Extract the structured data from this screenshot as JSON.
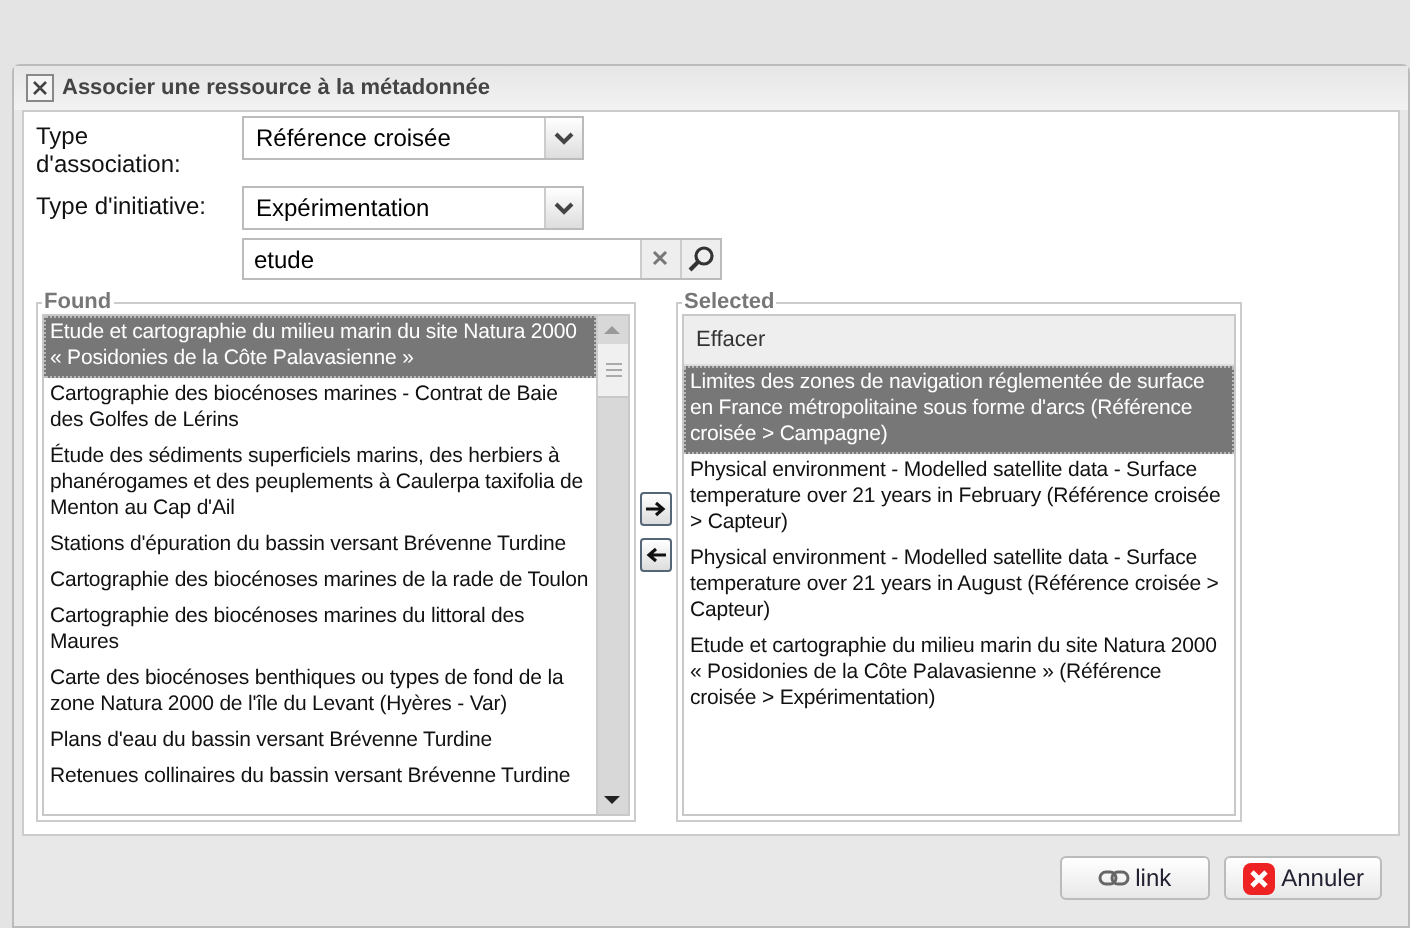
{
  "dialog": {
    "title": "Associer une ressource à la métadonnée",
    "fields": [
      {
        "kind": "select",
        "label": "Type d'association:",
        "value": "Référence croisée"
      },
      {
        "kind": "select",
        "label": "Type d'initiative:",
        "value": "Expérimentation"
      },
      {
        "kind": "search",
        "value": "etude"
      }
    ],
    "found": {
      "legend": "Found",
      "items": [
        {
          "text": "Etude et cartographie du milieu marin du site Natura 2000 « Posidonies de la Côte Palavasienne »",
          "selected": true
        },
        {
          "text": "Cartographie des biocénoses marines - Contrat de Baie des Golfes de Lérins",
          "selected": false
        },
        {
          "text": "Étude des sédiments superficiels marins, des herbiers à phanérogames et des peuplements à Caulerpa taxifolia de Menton au Cap d'Ail",
          "selected": false
        },
        {
          "text": "Stations d'épuration du bassin versant Brévenne Turdine",
          "selected": false
        },
        {
          "text": "Cartographie des biocénoses marines de la rade de Toulon",
          "selected": false
        },
        {
          "text": "Cartographie des biocénoses marines du littoral des Maures",
          "selected": false
        },
        {
          "text": "Carte des biocénoses benthiques ou types de fond de la zone Natura 2000 de l'île du Levant (Hyères - Var)",
          "selected": false
        },
        {
          "text": "Plans d'eau du bassin versant Brévenne Turdine",
          "selected": false
        },
        {
          "text": "Retenues collinaires du bassin versant Brévenne Turdine",
          "selected": false
        }
      ]
    },
    "selected_list": {
      "legend": "Selected",
      "header": "Effacer",
      "items": [
        {
          "text": "Limites des zones de navigation réglementée de surface en France métropolitaine sous forme d'arcs (Référence croisée > Campagne)",
          "selected": true
        },
        {
          "text": "Physical environment - Modelled satellite data - Surface temperature over 21 years in February (Référence croisée > Capteur)",
          "selected": false
        },
        {
          "text": "Physical environment - Modelled satellite data - Surface temperature over 21 years in August (Référence croisée > Capteur)",
          "selected": false
        },
        {
          "text": "Etude et cartographie du milieu marin du site Natura 2000 « Posidonies de la Côte Palavasienne » (Référence croisée > Expérimentation)",
          "selected": false
        }
      ]
    },
    "buttons": [
      {
        "kind": "link",
        "label": "link"
      },
      {
        "kind": "cancel",
        "label": "Annuler"
      }
    ]
  }
}
